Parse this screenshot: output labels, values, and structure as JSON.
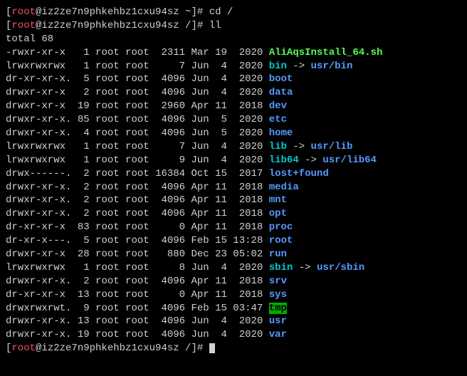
{
  "prompt1": {
    "open": "[",
    "user": "root",
    "at": "@",
    "host": "iz2ze7n9phkehbz1cxu94sz",
    "path": " ~",
    "close": "]# ",
    "command": "cd /"
  },
  "prompt2": {
    "open": "[",
    "user": "root",
    "at": "@",
    "host": "iz2ze7n9phkehbz1cxu94sz",
    "path": " /",
    "close": "]# ",
    "command": "ll"
  },
  "total": "total 68",
  "rows": [
    {
      "perm": "-rwxr-xr-x ",
      "links": "  1",
      "owner": " root",
      "group": " root",
      "size": "  2311",
      "date": " Mar 19  2020 ",
      "name": "AliAqsInstall_64.sh",
      "style": "green",
      "arrow": "",
      "target": "",
      "tstyle": ""
    },
    {
      "perm": "lrwxrwxrwx ",
      "links": "  1",
      "owner": " root",
      "group": " root",
      "size": "     7",
      "date": " Jun  4  2020 ",
      "name": "bin",
      "style": "cyan",
      "arrow": " -> ",
      "target": "usr/bin",
      "tstyle": "blue"
    },
    {
      "perm": "dr-xr-xr-x.",
      "links": "  5",
      "owner": " root",
      "group": " root",
      "size": "  4096",
      "date": " Jun  4  2020 ",
      "name": "boot",
      "style": "blue",
      "arrow": "",
      "target": "",
      "tstyle": ""
    },
    {
      "perm": "drwxr-xr-x ",
      "links": "  2",
      "owner": " root",
      "group": " root",
      "size": "  4096",
      "date": " Jun  4  2020 ",
      "name": "data",
      "style": "blue",
      "arrow": "",
      "target": "",
      "tstyle": ""
    },
    {
      "perm": "drwxr-xr-x ",
      "links": " 19",
      "owner": " root",
      "group": " root",
      "size": "  2960",
      "date": " Apr 11  2018 ",
      "name": "dev",
      "style": "blue",
      "arrow": "",
      "target": "",
      "tstyle": ""
    },
    {
      "perm": "drwxr-xr-x.",
      "links": " 85",
      "owner": " root",
      "group": " root",
      "size": "  4096",
      "date": " Jun  5  2020 ",
      "name": "etc",
      "style": "blue",
      "arrow": "",
      "target": "",
      "tstyle": ""
    },
    {
      "perm": "drwxr-xr-x.",
      "links": "  4",
      "owner": " root",
      "group": " root",
      "size": "  4096",
      "date": " Jun  5  2020 ",
      "name": "home",
      "style": "blue",
      "arrow": "",
      "target": "",
      "tstyle": ""
    },
    {
      "perm": "lrwxrwxrwx ",
      "links": "  1",
      "owner": " root",
      "group": " root",
      "size": "     7",
      "date": " Jun  4  2020 ",
      "name": "lib",
      "style": "cyan",
      "arrow": " -> ",
      "target": "usr/lib",
      "tstyle": "blue"
    },
    {
      "perm": "lrwxrwxrwx ",
      "links": "  1",
      "owner": " root",
      "group": " root",
      "size": "     9",
      "date": " Jun  4  2020 ",
      "name": "lib64",
      "style": "cyan",
      "arrow": " -> ",
      "target": "usr/lib64",
      "tstyle": "blue"
    },
    {
      "perm": "drwx------.",
      "links": "  2",
      "owner": " root",
      "group": " root",
      "size": " 16384",
      "date": " Oct 15  2017 ",
      "name": "lost+found",
      "style": "blue",
      "arrow": "",
      "target": "",
      "tstyle": ""
    },
    {
      "perm": "drwxr-xr-x.",
      "links": "  2",
      "owner": " root",
      "group": " root",
      "size": "  4096",
      "date": " Apr 11  2018 ",
      "name": "media",
      "style": "blue",
      "arrow": "",
      "target": "",
      "tstyle": ""
    },
    {
      "perm": "drwxr-xr-x.",
      "links": "  2",
      "owner": " root",
      "group": " root",
      "size": "  4096",
      "date": " Apr 11  2018 ",
      "name": "mnt",
      "style": "blue",
      "arrow": "",
      "target": "",
      "tstyle": ""
    },
    {
      "perm": "drwxr-xr-x.",
      "links": "  2",
      "owner": " root",
      "group": " root",
      "size": "  4096",
      "date": " Apr 11  2018 ",
      "name": "opt",
      "style": "blue",
      "arrow": "",
      "target": "",
      "tstyle": ""
    },
    {
      "perm": "dr-xr-xr-x ",
      "links": " 83",
      "owner": " root",
      "group": " root",
      "size": "     0",
      "date": " Apr 11  2018 ",
      "name": "proc",
      "style": "blue",
      "arrow": "",
      "target": "",
      "tstyle": ""
    },
    {
      "perm": "dr-xr-x---.",
      "links": "  5",
      "owner": " root",
      "group": " root",
      "size": "  4096",
      "date": " Feb 15 13:28 ",
      "name": "root",
      "style": "blue",
      "arrow": "",
      "target": "",
      "tstyle": ""
    },
    {
      "perm": "drwxr-xr-x ",
      "links": " 28",
      "owner": " root",
      "group": " root",
      "size": "   880",
      "date": " Dec 23 05:02 ",
      "name": "run",
      "style": "blue",
      "arrow": "",
      "target": "",
      "tstyle": ""
    },
    {
      "perm": "lrwxrwxrwx ",
      "links": "  1",
      "owner": " root",
      "group": " root",
      "size": "     8",
      "date": " Jun  4  2020 ",
      "name": "sbin",
      "style": "cyan",
      "arrow": " -> ",
      "target": "usr/sbin",
      "tstyle": "blue"
    },
    {
      "perm": "drwxr-xr-x.",
      "links": "  2",
      "owner": " root",
      "group": " root",
      "size": "  4096",
      "date": " Apr 11  2018 ",
      "name": "srv",
      "style": "blue",
      "arrow": "",
      "target": "",
      "tstyle": ""
    },
    {
      "perm": "dr-xr-xr-x ",
      "links": " 13",
      "owner": " root",
      "group": " root",
      "size": "     0",
      "date": " Apr 11  2018 ",
      "name": "sys",
      "style": "blue",
      "arrow": "",
      "target": "",
      "tstyle": ""
    },
    {
      "perm": "drwxrwxrwt.",
      "links": "  9",
      "owner": " root",
      "group": " root",
      "size": "  4096",
      "date": " Feb 15 03:47 ",
      "name": "tmp",
      "style": "highlight",
      "arrow": "",
      "target": "",
      "tstyle": ""
    },
    {
      "perm": "drwxr-xr-x.",
      "links": " 13",
      "owner": " root",
      "group": " root",
      "size": "  4096",
      "date": " Jun  4  2020 ",
      "name": "usr",
      "style": "blue",
      "arrow": "",
      "target": "",
      "tstyle": ""
    },
    {
      "perm": "drwxr-xr-x.",
      "links": " 19",
      "owner": " root",
      "group": " root",
      "size": "  4096",
      "date": " Jun  4  2020 ",
      "name": "var",
      "style": "blue",
      "arrow": "",
      "target": "",
      "tstyle": ""
    }
  ],
  "prompt3": {
    "open": "[",
    "user": "root",
    "at": "@",
    "host": "iz2ze7n9phkehbz1cxu94sz",
    "path": " /",
    "close": "]# "
  }
}
